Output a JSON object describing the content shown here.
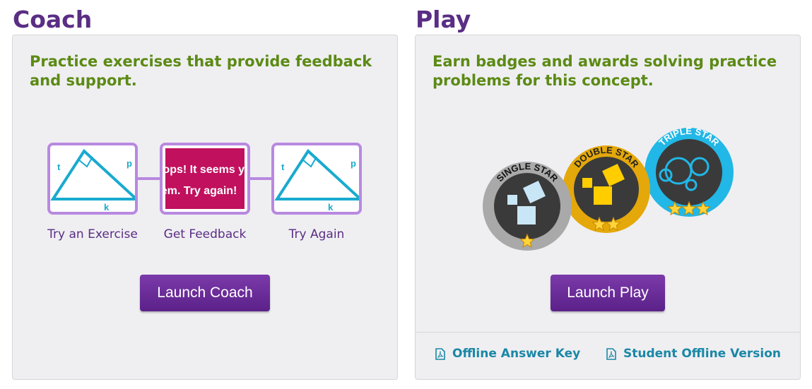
{
  "coach": {
    "title": "Coach",
    "description": "Practice exercises that provide feedback and support.",
    "steps": [
      {
        "label": "Try an Exercise",
        "icon": "triangle-diagram-icon",
        "side_labels": [
          "t",
          "p",
          "k"
        ]
      },
      {
        "label": "Get Feedback",
        "icon": "feedback-message-icon",
        "message_lines": [
          "Oops! It seems yo",
          "hem. Try again!"
        ]
      },
      {
        "label": "Try Again",
        "icon": "triangle-diagram-icon",
        "side_labels": [
          "t",
          "p",
          "k"
        ]
      }
    ],
    "button": "Launch Coach"
  },
  "play": {
    "title": "Play",
    "description": "Earn badges and awards solving practice problems for this concept.",
    "badges": [
      {
        "name": "SINGLE STAR",
        "stars": 1,
        "icon": "single-star-badge-icon"
      },
      {
        "name": "DOUBLE STAR",
        "stars": 2,
        "icon": "double-star-badge-icon"
      },
      {
        "name": "TRIPLE STAR",
        "stars": 3,
        "icon": "triple-star-badge-icon"
      }
    ],
    "button": "Launch Play",
    "links": [
      {
        "label": "Offline Answer Key",
        "icon": "pdf-icon"
      },
      {
        "label": "Student Offline Version",
        "icon": "pdf-icon"
      }
    ]
  },
  "colors": {
    "title": "#5a2e84",
    "description": "#5c8a14",
    "button": "#6a2b9a",
    "link": "#1a87a6",
    "feedback": "#c0105e",
    "step_border": "#b889e0"
  }
}
